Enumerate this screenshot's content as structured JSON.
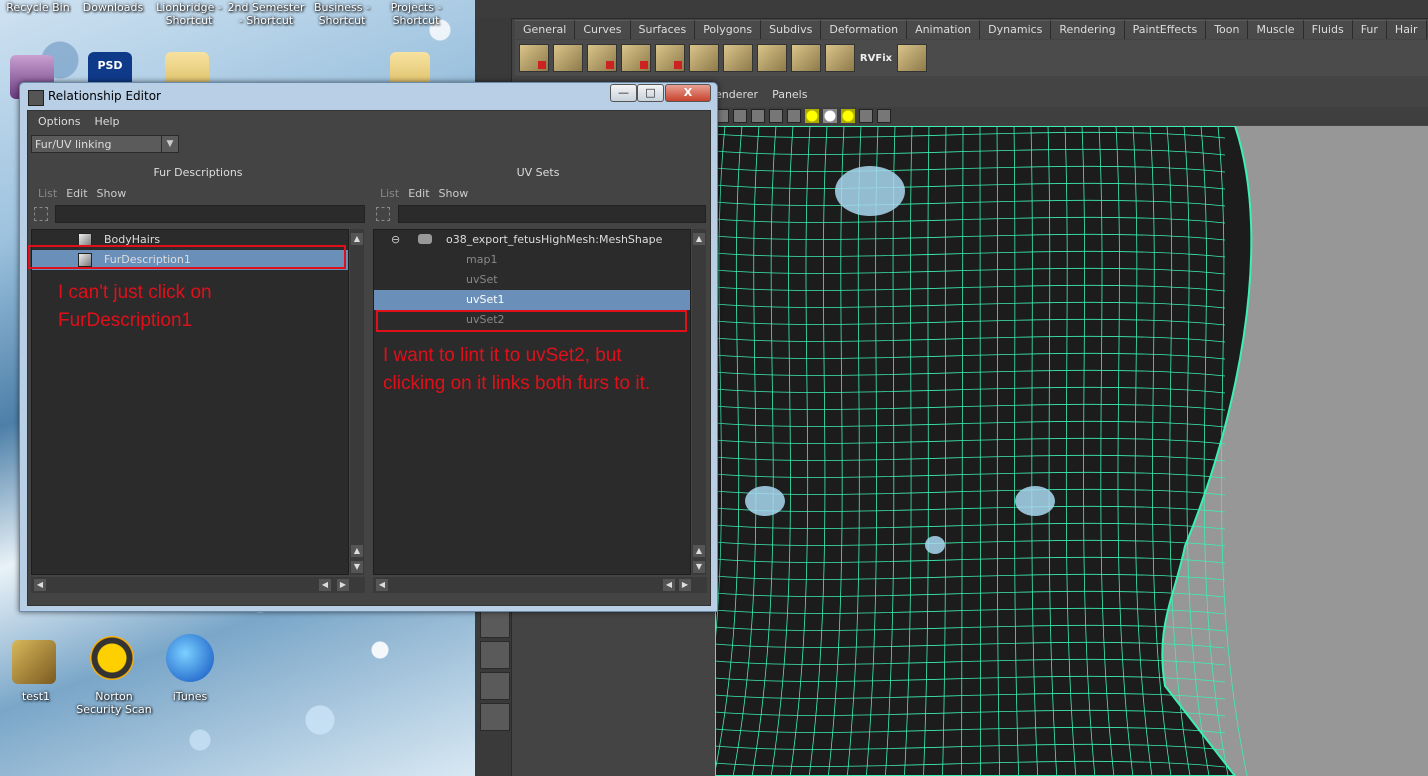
{
  "desktop": {
    "icons_top": [
      {
        "name": "recycle-bin",
        "label": "Recycle Bin"
      },
      {
        "name": "downloads",
        "label": "Downloads"
      },
      {
        "name": "lionbridge",
        "label": "Lionbridge -\nShortcut"
      },
      {
        "name": "2nd-semester",
        "label": "2nd Semester\n- Shortcut"
      },
      {
        "name": "business",
        "label": "Business -\nShortcut"
      },
      {
        "name": "projects",
        "label": "Projects -\nShortcut"
      }
    ],
    "icons_bottom": [
      {
        "name": "test1",
        "label": "test1"
      },
      {
        "name": "norton",
        "label": "Norton\nSecurity Scan"
      },
      {
        "name": "itunes",
        "label": "iTunes"
      }
    ],
    "psd_badge": "PSD"
  },
  "maya": {
    "shelf_tabs": [
      "General",
      "Curves",
      "Surfaces",
      "Polygons",
      "Subdivs",
      "Deformation",
      "Animation",
      "Dynamics",
      "Rendering",
      "PaintEffects",
      "Toon",
      "Muscle",
      "Fluids",
      "Fur",
      "Hair"
    ],
    "rvfix_label": "RVFix",
    "panel_menu": [
      "enderer",
      "Panels"
    ]
  },
  "relationship_editor": {
    "title": "Relationship Editor",
    "window_buttons": {
      "minimize": "—",
      "maximize": "□",
      "close": "X"
    },
    "menu": [
      "Options",
      "Help"
    ],
    "mode": "Fur/UV linking",
    "left_pane": {
      "title": "Fur Descriptions",
      "menu": [
        "List",
        "Edit",
        "Show"
      ],
      "items": [
        {
          "label": "BodyHairs",
          "selected": false
        },
        {
          "label": "FurDescription1",
          "selected": true
        }
      ]
    },
    "right_pane": {
      "title": "UV Sets",
      "menu": [
        "List",
        "Edit",
        "Show"
      ],
      "mesh": "o38_export_fetusHighMesh:MeshShape",
      "collapse_symbol": "⊖",
      "items": [
        {
          "label": "map1",
          "selected": false
        },
        {
          "label": "uvSet",
          "selected": false
        },
        {
          "label": "uvSet1",
          "selected": true
        },
        {
          "label": "uvSet2",
          "selected": false
        }
      ]
    }
  },
  "annotations": {
    "left_note_line1": "I can't just click on",
    "left_note_line2": "FurDescription1",
    "right_note_line1": "I want to lint it to uvSet2, but",
    "right_note_line2": "clicking on it links both furs to it."
  },
  "colors": {
    "annotation_red": "#e0101a",
    "selection_blue": "#6a8fb8",
    "wireframe": "#3cf0b0"
  }
}
